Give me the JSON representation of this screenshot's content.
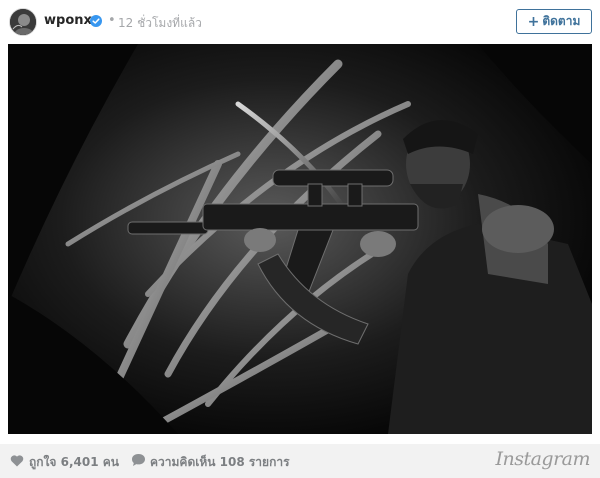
{
  "post": {
    "username": "wponx",
    "separator": "•",
    "timestamp": "12 ชั่วโมงที่แล้ว",
    "follow_label": "ติดตาม",
    "follow_plus": "+",
    "photo_description_icon": "photo-icon"
  },
  "footer": {
    "likes": "ถูกใจ 6,401 คน",
    "comments": "ความคิดเห็น 108 รายการ",
    "brand": "Instagram"
  },
  "colors": {
    "accent": "#3f729b",
    "verified": "#3897f0",
    "muted": "#a5a7aa",
    "footer_bg": "#f2f2f2"
  }
}
